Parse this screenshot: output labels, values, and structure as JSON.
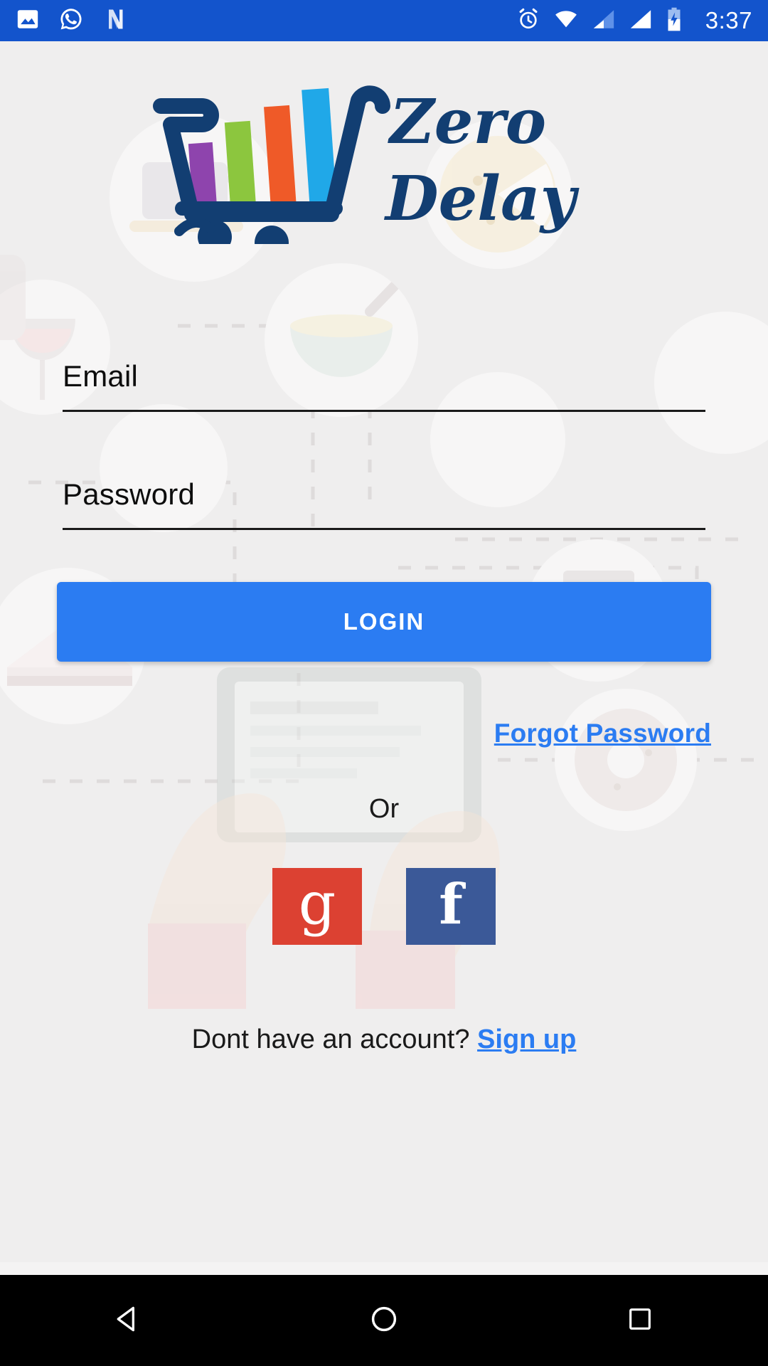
{
  "status_bar": {
    "time": "3:37",
    "background_color": "#1354cc",
    "left_icons": [
      "photo-icon",
      "whatsapp-icon",
      "netflix-n-icon"
    ],
    "right_icons": [
      "alarm-icon",
      "wifi-icon",
      "signal-sim1-icon",
      "signal-sim2-icon",
      "battery-charging-icon"
    ]
  },
  "brand": {
    "name_line1": "Zero",
    "name_line2": "Delay",
    "logo_icon": "shopping-cart-chart-smiley-logo",
    "primary_color": "#123e72",
    "bar_colors": [
      "#8e44ad",
      "#8cc63e",
      "#ef5a28",
      "#20a8e8"
    ]
  },
  "form": {
    "email": {
      "label": "Email",
      "placeholder": "Email",
      "value": ""
    },
    "password": {
      "label": "Password",
      "placeholder": "Password",
      "value": ""
    },
    "login_button": "LOGIN",
    "login_button_color": "#2b7cf2",
    "forgot_password": "Forgot Password"
  },
  "divider": {
    "or_label": "Or"
  },
  "social": {
    "google": {
      "label": "g",
      "name": "google-sign-in",
      "color": "#dc4132"
    },
    "facebook": {
      "label": "f",
      "name": "facebook-sign-in",
      "color": "#3b5998"
    }
  },
  "signup": {
    "prompt": "Dont have an account?",
    "link": "Sign up",
    "link_color": "#2b7cf2"
  },
  "nav_bar": {
    "back": "back-triangle-icon",
    "home": "home-circle-icon",
    "recents": "recents-square-icon",
    "background_color": "#000000"
  }
}
